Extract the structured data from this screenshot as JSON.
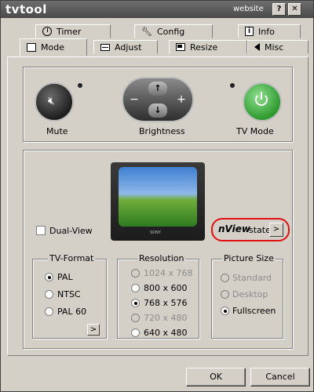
{
  "window": {
    "title": "tvtool",
    "website_label": "website",
    "help_button": "?",
    "close_button": "✕"
  },
  "tabs": {
    "row1": [
      {
        "label": "Timer",
        "icon": "clock-icon"
      },
      {
        "label": "Config",
        "icon": "wrench-icon"
      },
      {
        "label": "Info",
        "icon": "info-icon"
      }
    ],
    "row2": [
      {
        "label": "Mode",
        "icon": "monitor-icon",
        "active": true
      },
      {
        "label": "Adjust",
        "icon": "adjust-icon"
      },
      {
        "label": "Resize",
        "icon": "resize-icon"
      },
      {
        "label": "Misc",
        "icon": "speaker-icon"
      }
    ]
  },
  "controls": {
    "mute_label": "Mute",
    "brightness_label": "Brightness",
    "tvmode_label": "TV Mode",
    "brightness_minus": "−",
    "brightness_plus": "+",
    "brightness_up": "↑",
    "brightness_down": "↓"
  },
  "display": {
    "dualview_label": "Dual-View",
    "dualview_checked": false,
    "nview_brand": "nView",
    "nview_state_label": "state",
    "nview_button": ">",
    "tv_brand": "SONY"
  },
  "tv_format": {
    "title": "TV-Format",
    "options": [
      {
        "label": "PAL",
        "selected": true,
        "enabled": true
      },
      {
        "label": "NTSC",
        "selected": false,
        "enabled": true
      },
      {
        "label": "PAL 60",
        "selected": false,
        "enabled": true
      }
    ],
    "more_button": ">"
  },
  "resolution": {
    "title": "Resolution",
    "options": [
      {
        "label": "1024 x 768",
        "selected": false,
        "enabled": false
      },
      {
        "label": "800 x 600",
        "selected": false,
        "enabled": true
      },
      {
        "label": "768 x 576",
        "selected": true,
        "enabled": true
      },
      {
        "label": "720 x 480",
        "selected": false,
        "enabled": false
      },
      {
        "label": "640 x 480",
        "selected": false,
        "enabled": true
      }
    ]
  },
  "picture_size": {
    "title": "Picture Size",
    "options": [
      {
        "label": "Standard",
        "selected": false,
        "enabled": false
      },
      {
        "label": "Desktop",
        "selected": false,
        "enabled": false
      },
      {
        "label": "Fullscreen",
        "selected": true,
        "enabled": true
      }
    ]
  },
  "footer": {
    "ok_label": "OK",
    "cancel_label": "Cancel"
  },
  "colors": {
    "face": "#d4d0c8",
    "titlebar": "#555555",
    "tvmode_green": "#3fae3f",
    "highlight_red": "#e01010"
  }
}
